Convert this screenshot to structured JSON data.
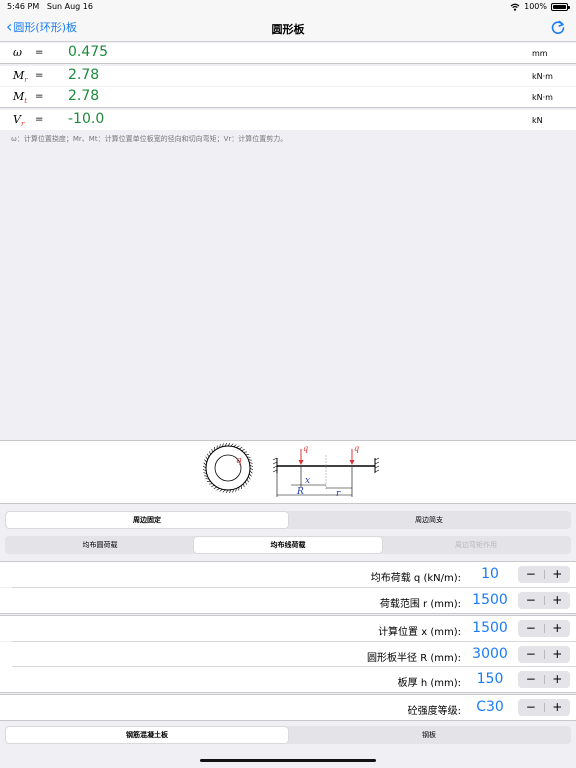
{
  "status_bar": {
    "time": "5:46 PM",
    "date": "Sun Aug 16",
    "battery": "100%"
  },
  "nav": {
    "back_label": "圆形(环形)板",
    "title": "圆形板"
  },
  "results": [
    {
      "symbol": "ω",
      "sub": "",
      "eq": "=",
      "value": "0.475",
      "unit": "mm"
    },
    {
      "symbol": "M",
      "sub": "r",
      "eq": "=",
      "value": "2.78",
      "unit": "kN·m"
    },
    {
      "symbol": "M",
      "sub": "t",
      "eq": "=",
      "value": "2.78",
      "unit": "kN·m"
    },
    {
      "symbol": "V",
      "sub": "r",
      "eq": "=",
      "value": "-10.0",
      "unit": "kN"
    }
  ],
  "note": "ω：计算位置挠度；Mr、Mt：计算位置单位板宽的径向和切向弯矩；Vr：计算位置剪力。",
  "diagram": {
    "load_label": "q",
    "x_label": "x",
    "R_label": "R",
    "r_label": "r"
  },
  "support_segment": {
    "options": [
      "周边固定",
      "周边简支"
    ],
    "selected": 0
  },
  "load_segment": {
    "options": [
      "均布圆荷载",
      "均布线荷载",
      "周边弯矩作用"
    ],
    "selected": 1,
    "disabled": [
      2
    ]
  },
  "inputs": {
    "q": {
      "label": "均布荷载  q (kN/m):",
      "value": "10"
    },
    "r": {
      "label": "荷载范围  r (mm):",
      "value": "1500"
    },
    "x": {
      "label": "计算位置  x (mm):",
      "value": "1500"
    },
    "R": {
      "label": "圆形板半径  R (mm):",
      "value": "3000"
    },
    "h": {
      "label": "板厚  h (mm):",
      "value": "150"
    },
    "grade": {
      "label": "砼强度等级:",
      "value": "C30"
    }
  },
  "stepper": {
    "minus": "−",
    "plus": "+"
  },
  "material_segment": {
    "options": [
      "钢筋混凝土板",
      "钢板"
    ],
    "selected": 0
  },
  "colors": {
    "accent": "#1a7cf5",
    "result_green": "#1e8a3c",
    "subscript_red": "#d33333"
  }
}
